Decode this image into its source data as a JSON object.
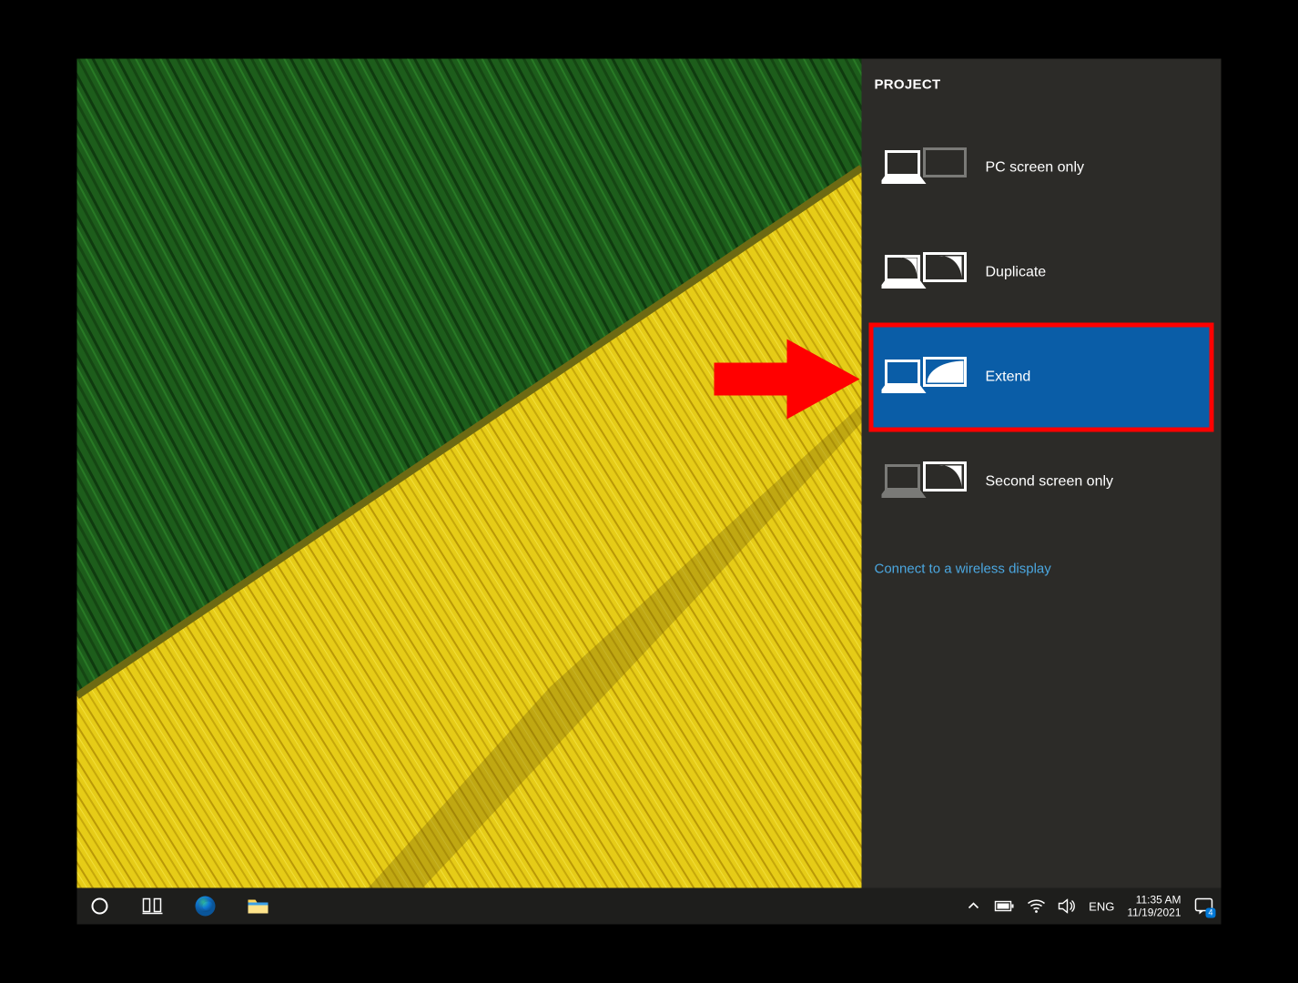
{
  "panel": {
    "title": "PROJECT",
    "options": [
      {
        "label": "PC screen only"
      },
      {
        "label": "Duplicate"
      },
      {
        "label": "Extend"
      },
      {
        "label": "Second screen only"
      }
    ],
    "wireless_link": "Connect to a wireless display",
    "accent_color": "#0a5da7",
    "selected_index": 2,
    "highlighted_index": 2
  },
  "annotation": {
    "arrow_color": "#ff0000",
    "box_color": "#ff0000"
  },
  "taskbar": {
    "lang": "ENG",
    "time": "11:35 AM",
    "date": "11/19/2021",
    "action_center_count": "4"
  }
}
